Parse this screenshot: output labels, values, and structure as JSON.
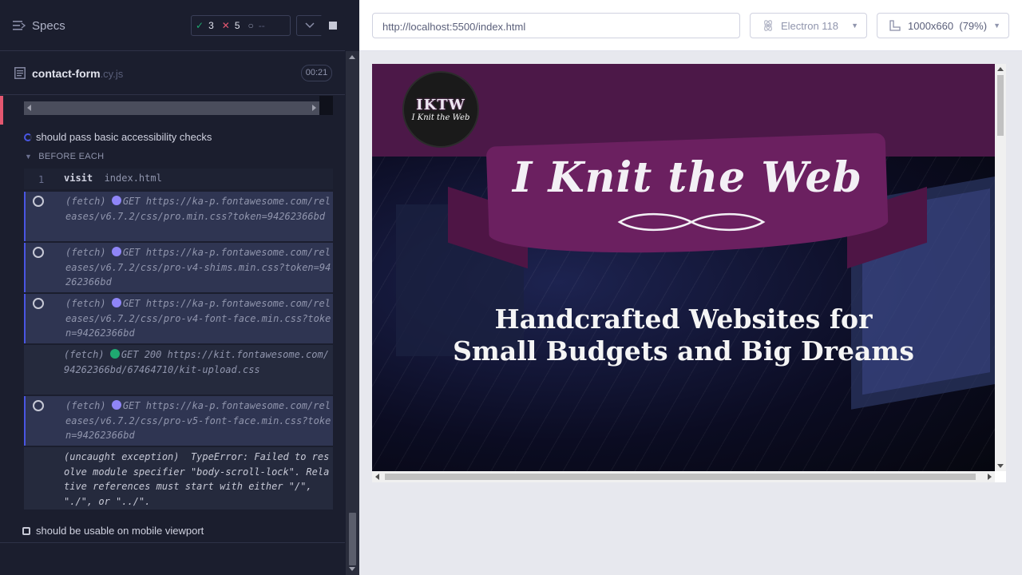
{
  "reporter": {
    "title": "Specs",
    "stats": {
      "passed": "3",
      "failed": "5",
      "pending": "--"
    },
    "spec": {
      "name": "contact-form",
      "ext": ".cy.js",
      "duration": "00:21"
    },
    "tests": {
      "current": "should pass basic accessibility checks",
      "hook_label": "BEFORE EACH",
      "next": "should be usable on mobile viewport"
    },
    "commands": [
      {
        "num": "1",
        "name": "visit",
        "message": "index.html"
      },
      {
        "type": "(fetch)",
        "method": "GET",
        "url": "https://ka-p.fontawesome.com/releases/v6.7.2/css/pro.min.css?token=94262366bd",
        "status": "pending"
      },
      {
        "type": "(fetch)",
        "method": "GET",
        "url": "https://ka-p.fontawesome.com/releases/v6.7.2/css/pro-v4-shims.min.css?token=94262366bd",
        "status": "pending"
      },
      {
        "type": "(fetch)",
        "method": "GET",
        "url": "https://ka-p.fontawesome.com/releases/v6.7.2/css/pro-v4-font-face.min.css?token=94262366bd",
        "status": "pending"
      },
      {
        "type": "(fetch)",
        "method": "GET 200",
        "url": "https://kit.fontawesome.com/94262366bd/67464710/kit-upload.css",
        "status": "success"
      },
      {
        "type": "(fetch)",
        "method": "GET",
        "url": "https://ka-p.fontawesome.com/releases/v6.7.2/css/pro-v5-font-face.min.css?token=94262366bd",
        "status": "pending"
      },
      {
        "type": "(uncaught exception)",
        "message": "TypeError: Failed to resolve module specifier \"body-scroll-lock\". Relative references must start with either \"/\", \"./\", or \"../\"."
      }
    ]
  },
  "aut": {
    "url": "http://localhost:5500/index.html",
    "browser": "Electron 118",
    "viewport": "1000x660",
    "zoom": "(79%)",
    "site": {
      "logo_abbr": "IKTW",
      "logo_name": "I Knit the Web",
      "brand": "I Knit the Web",
      "tagline_1": "Handcrafted Websites for",
      "tagline_2": "Small Budgets and Big Dreams"
    }
  },
  "colors": {
    "pending": "#8f85f7",
    "success": "#1fa971",
    "fail": "#e45770",
    "brand": "#4c1848"
  }
}
